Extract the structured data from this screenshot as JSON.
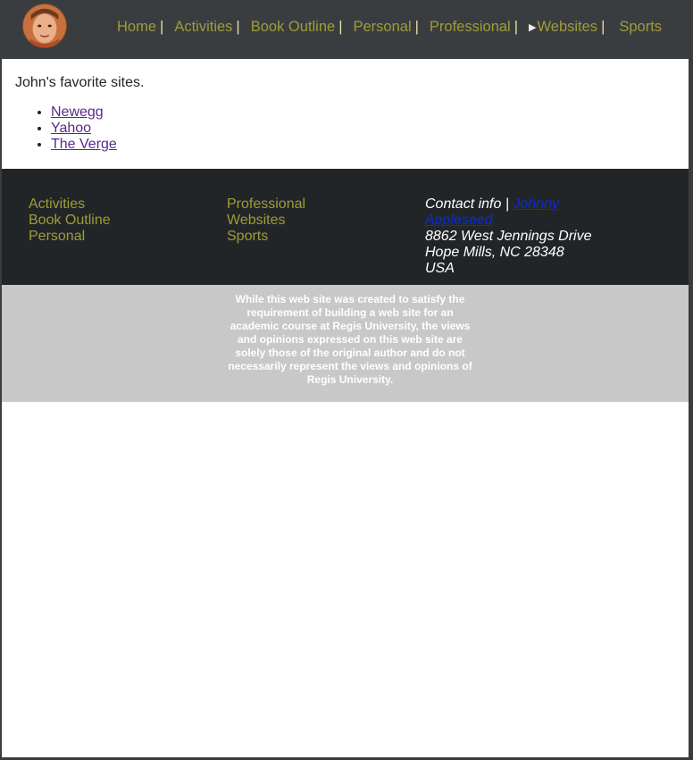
{
  "header": {
    "avatar_alt": "avatar",
    "nav": [
      {
        "label": "Home",
        "sep": "|"
      },
      {
        "label": "Activities",
        "sep": "|"
      },
      {
        "label": "Book Outline",
        "sep": "|"
      },
      {
        "label": "Personal",
        "sep": "|"
      },
      {
        "label": "Professional",
        "sep": "|"
      },
      {
        "label": "Websites",
        "sep": "|",
        "arrow": "▶"
      },
      {
        "label": "Sports"
      }
    ]
  },
  "main": {
    "intro": "John's favorite sites.",
    "links": [
      "Newegg",
      "Yahoo",
      "The Verge"
    ]
  },
  "footer": {
    "col1": [
      "Activities",
      "Book Outline",
      "Personal"
    ],
    "col2": [
      "Professional",
      "Websites",
      "Sports"
    ],
    "contact_prefix": "Contact info |",
    "contact_name": "Johnny Appleseed",
    "address_line1": "8862 West Jennings Drive",
    "address_line2": "Hope Mills, NC 28348",
    "address_line3": "USA"
  },
  "disclaimer": {
    "text": "While this web site was created to satisfy the requirement of building a web site for an academic course at Regis University, the views and opinions expressed on this web site are solely those of the original author and do not necessarily represent the views and opinions of Regis University."
  },
  "colors": {
    "header_bg": "#3a3d40",
    "footer_bg": "#222528",
    "nav_link": "#a09c36",
    "disclaimer_bg": "#c8c8c8",
    "visited_link": "#5a2a8a",
    "contact_link": "#0a2bd6"
  }
}
